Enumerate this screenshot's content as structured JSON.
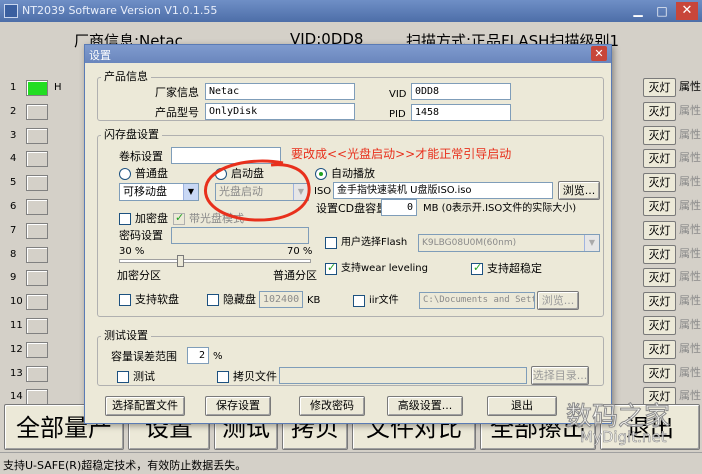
{
  "main": {
    "title": "NT2039 Software Version V1.0.1.55",
    "header": {
      "vendor": "厂商信息:Netac",
      "vid": "VID:0DD8",
      "scan_mode": "扫描方式:正品FLASH扫描级别1"
    },
    "rows": [
      "1",
      "2",
      "3",
      "4",
      "5",
      "6",
      "7",
      "8",
      "9",
      "10",
      "11",
      "12",
      "13",
      "14"
    ],
    "row1_letter": "H",
    "light_label": "灭灯",
    "attr_label": "属性",
    "bottom_buttons": [
      "全部量产",
      "设置",
      "测试",
      "拷贝",
      "文件对比",
      "全部擦出",
      "退出"
    ],
    "status": "支持U-SAFE(R)超稳定技术，有效防止数据丢失。",
    "watermark": {
      "line1": "数码之家",
      "line2": "MyDigit.net"
    },
    "colors": {
      "led_on": "#22dd22",
      "annotation": "#e8301c"
    }
  },
  "dialog": {
    "title": "设置",
    "product": {
      "group": "产品信息",
      "vendor_label": "厂家信息",
      "vendor_value": "Netac",
      "model_label": "产品型号",
      "model_value": "OnlyDisk",
      "vid_label": "VID",
      "vid_value": "0DD8",
      "pid_label": "PID",
      "pid_value": "1458"
    },
    "flash": {
      "group": "闪存盘设置",
      "volume_label": "卷标设置",
      "normal_disk": "普通盘",
      "boot_disk": "启动盘",
      "normal_type": "可移动盘",
      "boot_type": "光盘启动",
      "autoplay": "自动播放",
      "iso_label": "ISO",
      "iso_value": "金手指快速装机 U盘版ISO.iso",
      "browse": "浏览...",
      "cd_capacity_label": "设置CD盘容量",
      "cd_capacity_value": "0",
      "cd_capacity_note": "MB (0表示开.ISO文件的实际大小)",
      "encrypt_disk": "加密盘",
      "with_cd": "带光盘模式",
      "password_label": "密码设置",
      "pct_left": "30 %",
      "pct_right": "70 %",
      "encrypt_area": "加密分区",
      "normal_area": "普通分区",
      "user_flash_label": "用户选择Flash",
      "user_flash_value": "K9LBG08U0M(60nm)",
      "wear_leveling": "支持wear leveling",
      "super_stable": "支持超稳定",
      "floppy": "支持软盘",
      "hidden_disk": "隐藏盘",
      "hidden_value": "102400",
      "hidden_unit": "KB",
      "iir_label": "iir文件",
      "iir_value": "C:\\Documents and Sett",
      "iir_browse": "浏览..."
    },
    "test": {
      "group": "测试设置",
      "range_label": "容量误差范围",
      "range_value": "2",
      "range_unit": "%",
      "test_label": "测试",
      "copy_label": "拷贝文件",
      "select_dir": "选择目录..."
    },
    "buttons": [
      "选择配置文件",
      "保存设置",
      "修改密码",
      "高级设置...",
      "退出"
    ],
    "annotation": "要改成<<光盘启动>>才能正常引导启动"
  }
}
